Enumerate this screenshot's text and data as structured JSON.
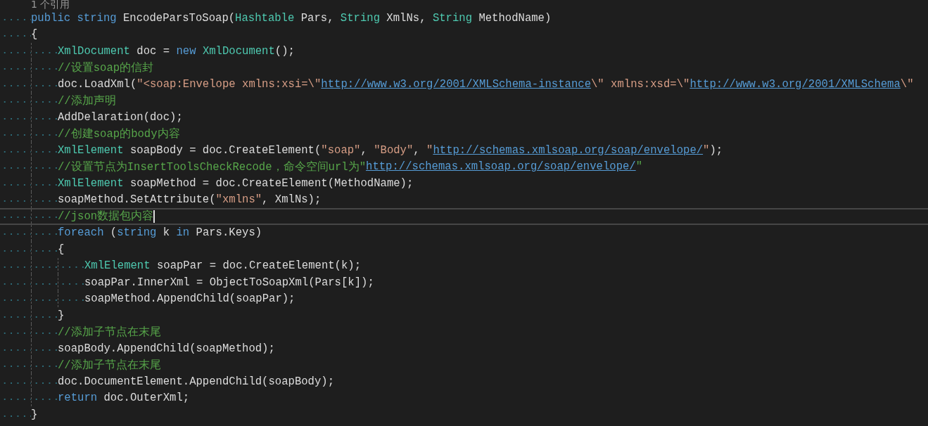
{
  "codelens": "1 个引用",
  "lines": [
    {
      "current": false,
      "tokens": [
        {
          "kind": "keyword",
          "text": "public string"
        },
        {
          "kind": "plain",
          "text": " EncodeParsToSoap("
        },
        {
          "kind": "type",
          "text": "Hashtable"
        },
        {
          "kind": "plain",
          "text": " Pars, "
        },
        {
          "kind": "type",
          "text": "String"
        },
        {
          "kind": "plain",
          "text": " XmlNs, "
        },
        {
          "kind": "type",
          "text": "String"
        },
        {
          "kind": "plain",
          "text": " MethodName)"
        }
      ]
    },
    {
      "current": false,
      "tokens": [
        {
          "kind": "plain",
          "text": "{"
        }
      ],
      "children": [
        {
          "current": false,
          "tokens": [
            {
              "kind": "type",
              "text": "XmlDocument"
            },
            {
              "kind": "plain",
              "text": " doc = "
            },
            {
              "kind": "keyword",
              "text": "new "
            },
            {
              "kind": "type",
              "text": "XmlDocument"
            },
            {
              "kind": "plain",
              "text": "();"
            }
          ]
        },
        {
          "current": false,
          "tokens": [
            {
              "kind": "comment",
              "text": "//设置soap的信封"
            }
          ]
        },
        {
          "current": false,
          "tokens": [
            {
              "kind": "plain",
              "text": "doc.LoadXml("
            },
            {
              "kind": "string",
              "text": "\"<soap:Envelope xmlns:xsi=\\\""
            },
            {
              "kind": "link",
              "text": "http://www.w3.org/2001/XMLSchema-instance"
            },
            {
              "kind": "string",
              "text": "\\\" xmlns:xsd=\\\""
            },
            {
              "kind": "link",
              "text": "http://www.w3.org/2001/XMLSchema"
            },
            {
              "kind": "string",
              "text": "\\\""
            }
          ]
        },
        {
          "current": false,
          "tokens": [
            {
              "kind": "comment",
              "text": "//添加声明"
            }
          ]
        },
        {
          "current": false,
          "tokens": [
            {
              "kind": "plain",
              "text": "AddDelaration(doc);"
            }
          ]
        },
        {
          "current": false,
          "tokens": [
            {
              "kind": "comment",
              "text": "//创建soap的body内容"
            }
          ]
        },
        {
          "current": false,
          "tokens": [
            {
              "kind": "type",
              "text": "XmlElement"
            },
            {
              "kind": "plain",
              "text": " soapBody = doc.CreateElement("
            },
            {
              "kind": "string",
              "text": "\"soap\""
            },
            {
              "kind": "plain",
              "text": ", "
            },
            {
              "kind": "string",
              "text": "\"Body\""
            },
            {
              "kind": "plain",
              "text": ", "
            },
            {
              "kind": "string",
              "text": "\""
            },
            {
              "kind": "link",
              "text": "http://schemas.xmlsoap.org/soap/envelope/"
            },
            {
              "kind": "string",
              "text": "\""
            },
            {
              "kind": "plain",
              "text": ");"
            }
          ]
        },
        {
          "current": false,
          "tokens": [
            {
              "kind": "comment",
              "text": "//设置节点为InsertToolsCheckRecode，命令空间url为\""
            },
            {
              "kind": "link",
              "text": "http://schemas.xmlsoap.org/soap/envelope/"
            },
            {
              "kind": "comment",
              "text": "\""
            }
          ]
        },
        {
          "current": false,
          "tokens": [
            {
              "kind": "type",
              "text": "XmlElement"
            },
            {
              "kind": "plain",
              "text": " soapMethod = doc.CreateElement(MethodName);"
            }
          ]
        },
        {
          "current": false,
          "tokens": [
            {
              "kind": "plain",
              "text": "soapMethod.SetAttribute("
            },
            {
              "kind": "string",
              "text": "\"xmlns\""
            },
            {
              "kind": "plain",
              "text": ", XmlNs);"
            }
          ]
        },
        {
          "current": true,
          "tokens": [
            {
              "kind": "comment",
              "text": "//json数据包内容"
            }
          ]
        },
        {
          "current": false,
          "tokens": [
            {
              "kind": "keyword",
              "text": "foreach"
            },
            {
              "kind": "plain",
              "text": " ("
            },
            {
              "kind": "keyword",
              "text": "string"
            },
            {
              "kind": "plain",
              "text": " k "
            },
            {
              "kind": "keyword",
              "text": "in"
            },
            {
              "kind": "plain",
              "text": " Pars.Keys)"
            }
          ]
        },
        {
          "current": false,
          "tokens": [
            {
              "kind": "plain",
              "text": "{"
            }
          ],
          "children": [
            {
              "current": false,
              "tokens": [
                {
                  "kind": "type",
                  "text": "XmlElement"
                },
                {
                  "kind": "plain",
                  "text": " soapPar = doc.CreateElement(k);"
                }
              ]
            },
            {
              "current": false,
              "tokens": [
                {
                  "kind": "plain",
                  "text": "soapPar.InnerXml = ObjectToSoapXml(Pars[k]);"
                }
              ]
            },
            {
              "current": false,
              "tokens": [
                {
                  "kind": "plain",
                  "text": "soapMethod.AppendChild(soapPar);"
                }
              ]
            }
          ]
        },
        {
          "current": false,
          "tokens": [
            {
              "kind": "plain",
              "text": "}"
            }
          ]
        },
        {
          "current": false,
          "tokens": [
            {
              "kind": "comment",
              "text": "//添加子节点在末尾"
            }
          ]
        },
        {
          "current": false,
          "tokens": [
            {
              "kind": "plain",
              "text": "soapBody.AppendChild(soapMethod);"
            }
          ]
        },
        {
          "current": false,
          "tokens": [
            {
              "kind": "comment",
              "text": "//添加子节点在末尾"
            }
          ]
        },
        {
          "current": false,
          "tokens": [
            {
              "kind": "plain",
              "text": "doc.DocumentElement.AppendChild(soapBody);"
            }
          ]
        },
        {
          "current": false,
          "tokens": [
            {
              "kind": "keyword",
              "text": "return"
            },
            {
              "kind": "plain",
              "text": " doc.OuterXml;"
            }
          ]
        }
      ]
    },
    {
      "current": false,
      "tokens": [
        {
          "kind": "plain",
          "text": "}"
        }
      ]
    }
  ]
}
